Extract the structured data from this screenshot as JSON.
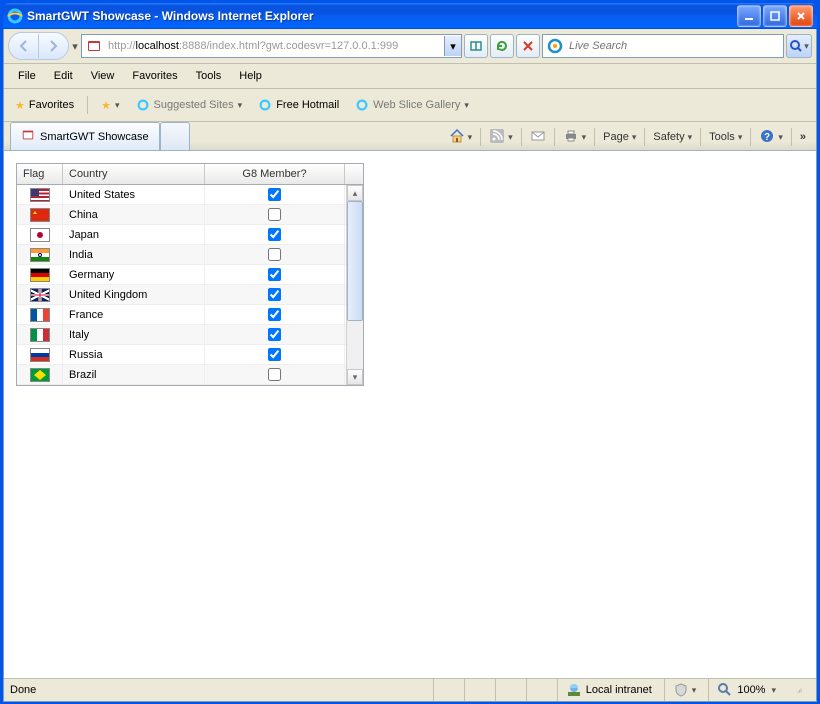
{
  "window": {
    "title": "SmartGWT Showcase - Windows Internet Explorer"
  },
  "address": {
    "protocol": "http://",
    "host": "localhost",
    "rest": ":8888/index.html?gwt.codesvr=127.0.0.1:999"
  },
  "search": {
    "placeholder": "Live Search"
  },
  "menubar": [
    "File",
    "Edit",
    "View",
    "Favorites",
    "Tools",
    "Help"
  ],
  "favbar": {
    "favorites": "Favorites",
    "suggested": "Suggested Sites",
    "hotmail": "Free Hotmail",
    "webslice": "Web Slice Gallery"
  },
  "tab": {
    "label": "SmartGWT Showcase"
  },
  "cmdbar": {
    "page": "Page",
    "safety": "Safety",
    "tools": "Tools"
  },
  "grid": {
    "headers": {
      "flag": "Flag",
      "country": "Country",
      "g8": "G8 Member?"
    },
    "rows": [
      {
        "country": "United States",
        "g8": true,
        "flag": "us"
      },
      {
        "country": "China",
        "g8": false,
        "flag": "cn"
      },
      {
        "country": "Japan",
        "g8": true,
        "flag": "jp"
      },
      {
        "country": "India",
        "g8": false,
        "flag": "in"
      },
      {
        "country": "Germany",
        "g8": true,
        "flag": "de"
      },
      {
        "country": "United Kingdom",
        "g8": true,
        "flag": "gb"
      },
      {
        "country": "France",
        "g8": true,
        "flag": "fr"
      },
      {
        "country": "Italy",
        "g8": true,
        "flag": "it"
      },
      {
        "country": "Russia",
        "g8": true,
        "flag": "ru"
      },
      {
        "country": "Brazil",
        "g8": false,
        "flag": "br"
      }
    ]
  },
  "status": {
    "done": "Done",
    "zone": "Local intranet",
    "zoom": "100%"
  }
}
